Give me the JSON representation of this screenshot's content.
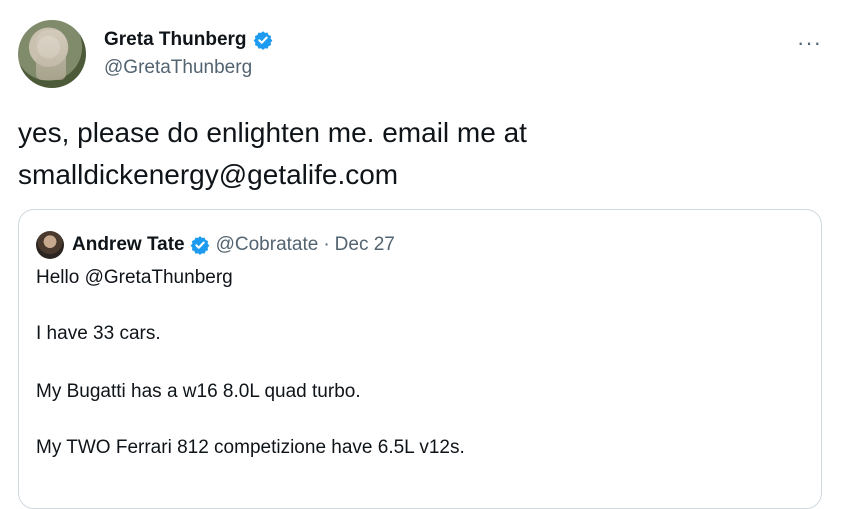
{
  "author": {
    "display_name": "Greta Thunberg",
    "handle": "@GretaThunberg"
  },
  "tweet": {
    "text_lines": [
      "yes, please do enlighten me. email me at",
      "smalldickenergy@getalife.com"
    ]
  },
  "quoted_tweet": {
    "display_name": "Andrew Tate",
    "handle": "@Cobratate",
    "separator": "·",
    "date": "Dec 27",
    "lines": [
      "Hello @GretaThunberg",
      "I have 33 cars.",
      "My Bugatti has a w16 8.0L quad turbo.",
      "My TWO Ferrari 812 competizione have 6.5L v12s."
    ]
  },
  "menu": {
    "more_label": "···"
  },
  "colors": {
    "text": "#0f1419",
    "secondary": "#536471",
    "verified_blue": "#1d9bf0",
    "border": "#cfd9de"
  },
  "icons": {
    "verified": "verified-badge-icon",
    "more": "more-options-icon"
  }
}
